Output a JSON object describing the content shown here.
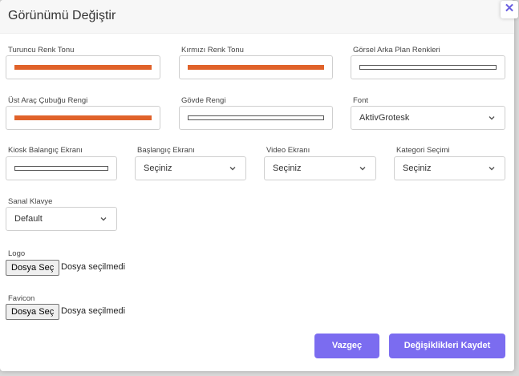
{
  "modal": {
    "title": "Görünümü Değiştir",
    "close_symbol": "✕"
  },
  "colors": {
    "accent": "#7b6cf0",
    "orange": "#e0622a"
  },
  "fields": {
    "turuncu": {
      "label": "Turuncu Renk Tonu",
      "swatch": "orange"
    },
    "kirmizi": {
      "label": "Kırmızı Renk Tonu",
      "swatch": "orange"
    },
    "gorsel_arka_plan": {
      "label": "Görsel Arka Plan Renkleri",
      "swatch": "white"
    },
    "ust_arac_cubugu": {
      "label": "Üst Araç Çubuğu Rengi",
      "swatch": "orange"
    },
    "govde": {
      "label": "Gövde Rengi",
      "swatch": "white"
    },
    "font": {
      "label": "Font",
      "value": "AktivGrotesk"
    },
    "kiosk_baslangic": {
      "label": "Kiosk Balangıç Ekranı",
      "swatch": "white"
    },
    "baslangic_ekrani": {
      "label": "Başlangıç Ekranı",
      "value": "Seçiniz"
    },
    "video_ekrani": {
      "label": "Video Ekranı",
      "value": "Seçiniz"
    },
    "kategori_secimi": {
      "label": "Kategori Seçimi",
      "value": "Seçiniz"
    },
    "sanal_klavye": {
      "label": "Sanal Klavye",
      "value": "Default"
    }
  },
  "uploads": {
    "logo": {
      "label": "Logo",
      "button": "Dosya Seç",
      "status": "Dosya seçilmedi"
    },
    "favicon": {
      "label": "Favicon",
      "button": "Dosya Seç",
      "status": "Dosya seçilmedi"
    }
  },
  "footer": {
    "cancel_label": "Vazgeç",
    "save_label": "Değişiklikleri Kaydet"
  }
}
